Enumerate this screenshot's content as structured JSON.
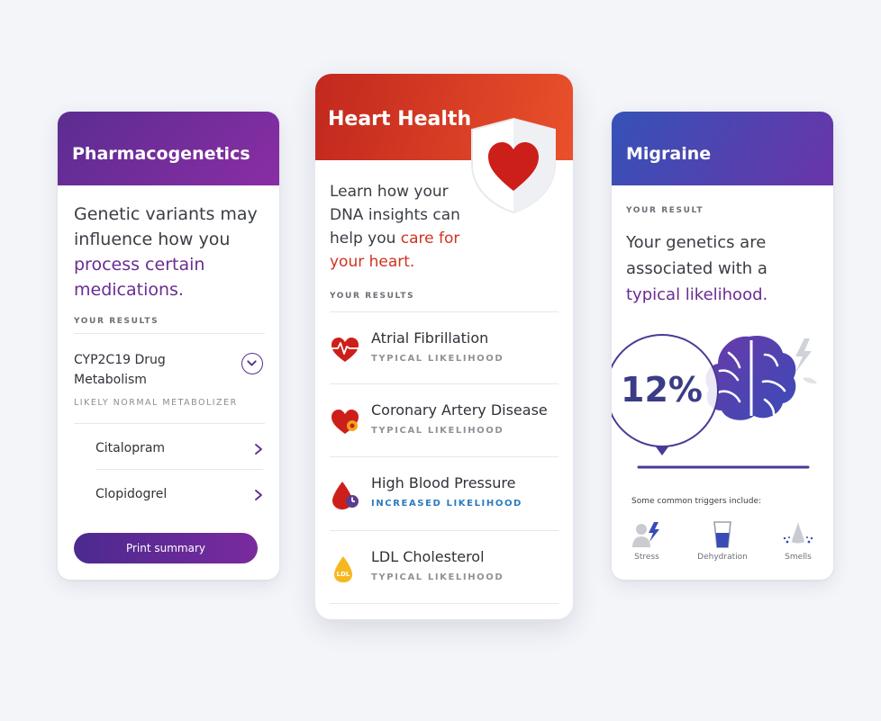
{
  "pharmacogenetics": {
    "title": "Pharmacogenetics",
    "intro_plain": "Genetic variants may influence how you",
    "intro_highlight": "process certain medications.",
    "results_label": "YOUR RESULTS",
    "drug": {
      "title_line1": "CYP2C19 Drug",
      "title_line2": "Metabolism",
      "status": "LIKELY NORMAL METABOLIZER"
    },
    "medications": [
      "Citalopram",
      "Clopidogrel"
    ],
    "print_button": "Print summary"
  },
  "heart_health": {
    "title": "Heart Health",
    "intro_plain": "Learn how your DNA insights can help you",
    "intro_highlight": "care for your heart.",
    "results_label": "YOUR RESULTS",
    "conditions": [
      {
        "name": "Atrial Fibrillation",
        "likelihood": "TYPICAL LIKELIHOOD",
        "icon": "heart-ecg-icon"
      },
      {
        "name": "Coronary Artery Disease",
        "likelihood": "TYPICAL LIKELIHOOD",
        "icon": "heart-artery-icon"
      },
      {
        "name": "High Blood Pressure",
        "likelihood": "INCREASED LIKELIHOOD",
        "icon": "blood-drop-gauge-icon"
      },
      {
        "name": "LDL Cholesterol",
        "likelihood": "TYPICAL LIKELIHOOD",
        "icon": "ldl-drop-icon"
      }
    ]
  },
  "migraine": {
    "title": "Migraine",
    "results_label": "YOUR RESULT",
    "intro_plain": "Your genetics are associated with a",
    "intro_highlight": "typical likelihood.",
    "percentage": "12%",
    "triggers_label": "Some common triggers include:",
    "triggers": [
      {
        "label": "Stress",
        "icon": "stress-icon"
      },
      {
        "label": "Dehydration",
        "icon": "water-glass-icon"
      },
      {
        "label": "Smells",
        "icon": "smell-icon"
      }
    ]
  },
  "colors": {
    "pharma_purple": "#5b2d91",
    "heart_red": "#c2281e",
    "migraine_blue": "#3552b8",
    "increased_blue": "#2b7bbf"
  }
}
